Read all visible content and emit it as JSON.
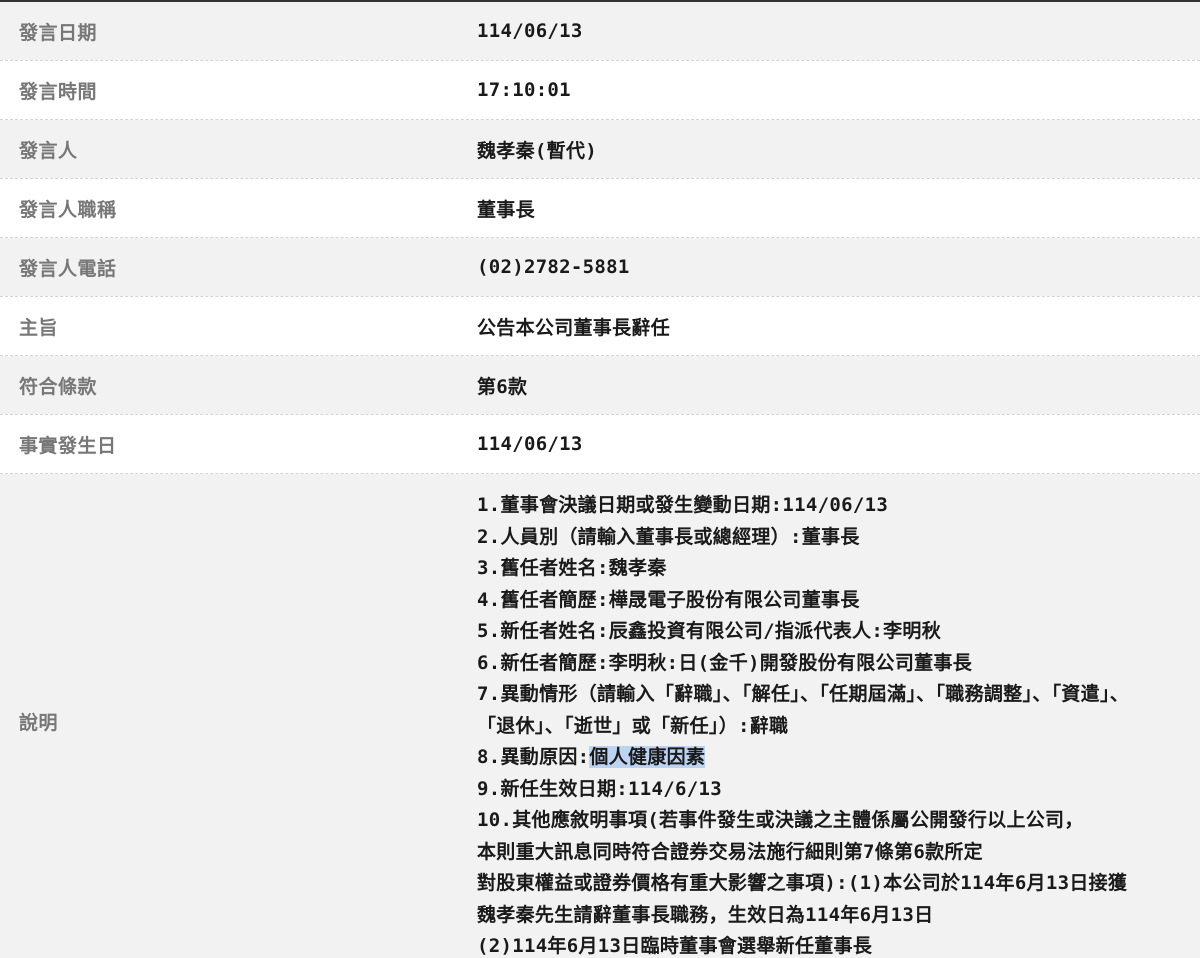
{
  "rows": [
    {
      "label": "發言日期",
      "value": "114/06/13"
    },
    {
      "label": "發言時間",
      "value": "17:10:01"
    },
    {
      "label": "發言人",
      "value": "魏孝秦(暫代)"
    },
    {
      "label": "發言人職稱",
      "value": "董事長"
    },
    {
      "label": "發言人電話",
      "value": "(02)2782-5881"
    },
    {
      "label": "主旨",
      "value": "公告本公司董事長辭任"
    },
    {
      "label": "符合條款",
      "value": "第6款"
    },
    {
      "label": "事實發生日",
      "value": "114/06/13"
    }
  ],
  "description": {
    "label": "說明",
    "lines": [
      "1.董事會決議日期或發生變動日期:114/06/13",
      "2.人員別（請輸入董事長或總經理）:董事長",
      "3.舊任者姓名:魏孝秦",
      "4.舊任者簡歷:樺晟電子股份有限公司董事長",
      "5.新任者姓名:辰鑫投資有限公司/指派代表人:李明秋",
      "6.新任者簡歷:李明秋:日(金千)開發股份有限公司董事長",
      "7.異動情形（請輸入「辭職」、「解任」、「任期屆滿」、「職務調整」、「資遣」、",
      "「退休」、「逝世」或「新任」）:辭職",
      "9.新任生效日期:114/6/13",
      "10.其他應敘明事項(若事件發生或決議之主體係屬公開發行以上公司，",
      "本則重大訊息同時符合證券交易法施行細則第7條第6款所定",
      "對股東權益或證券價格有重大影響之事項):(1)本公司於114年6月13日接獲",
      "魏孝秦先生請辭董事長職務，生效日為114年6月13日",
      "(2)114年6月13日臨時董事會選舉新任董事長"
    ],
    "line8_prefix": "8.異動原因:",
    "line8_highlight": "個人健康因素"
  },
  "colors": {
    "shade": "#f2f2f2",
    "label_text": "#777777",
    "value_text": "#1a1a1a",
    "highlight": "#bcd3f2"
  }
}
